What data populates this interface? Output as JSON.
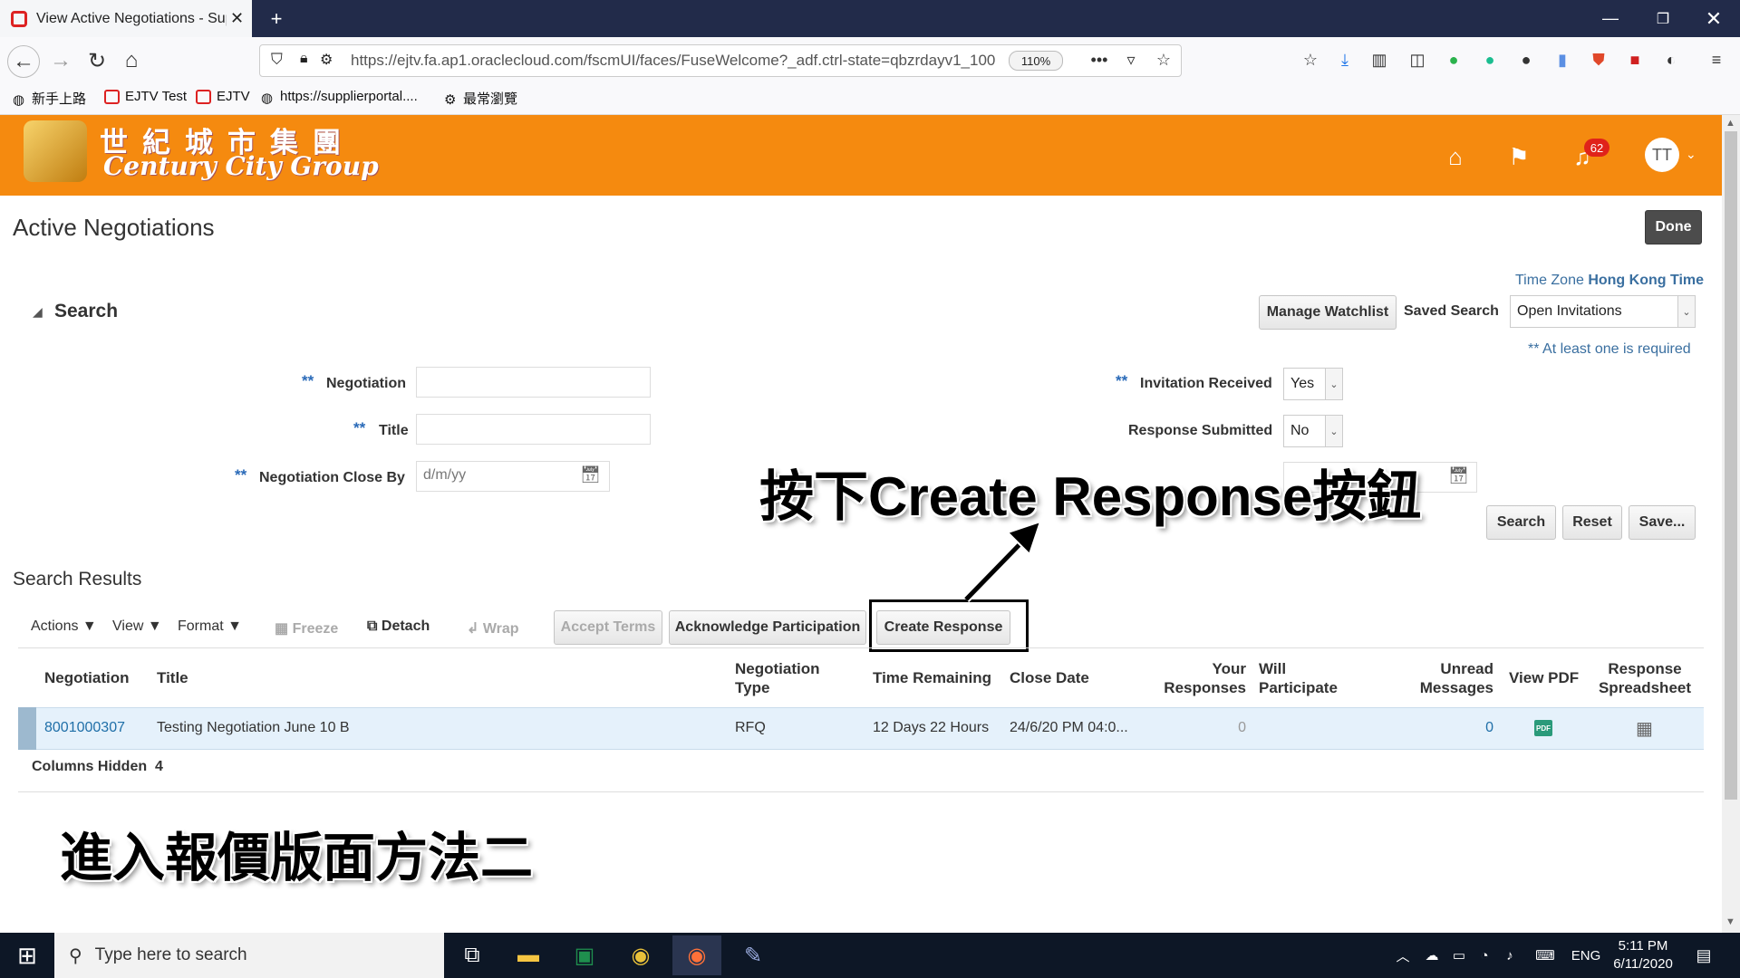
{
  "browser": {
    "tab_title": "View Active Negotiations - Sup",
    "url": "https://ejtv.fa.ap1.oraclecloud.com/fscmUI/faces/FuseWelcome?_adf.ctrl-state=qbzrdayv1_100",
    "zoom": "110%",
    "bookmarks": [
      "新手上路",
      "EJTV Test",
      "EJTV",
      "https://supplierportal....",
      "最常瀏覽"
    ]
  },
  "header": {
    "brand_cn": "世紀城市集團",
    "brand_en": "Century City Group",
    "notification_count": "62",
    "avatar_initials": "TT"
  },
  "page": {
    "title": "Active Negotiations",
    "done_label": "Done",
    "timezone_label": "Time Zone",
    "timezone_value": "Hong Kong Time",
    "search_section": "Search",
    "manage_watchlist": "Manage Watchlist",
    "saved_search_label": "Saved Search",
    "saved_search_value": "Open Invitations",
    "required_note": "** At least one is required",
    "fields": {
      "negotiation_label": "Negotiation",
      "title_label": "Title",
      "close_by_label": "Negotiation Close By",
      "close_by_placeholder": "d/m/yy",
      "invitation_received_label": "Invitation Received",
      "invitation_received_value": "Yes",
      "response_submitted_label": "Response Submitted",
      "response_submitted_value": "No",
      "req_marker": "**"
    },
    "search_button": "Search",
    "reset_button": "Reset",
    "save_button": "Save..."
  },
  "results": {
    "heading": "Search Results",
    "toolbar": {
      "actions": "Actions",
      "view": "View",
      "format": "Format",
      "freeze": "Freeze",
      "detach": "Detach",
      "wrap": "Wrap",
      "accept_terms": "Accept Terms",
      "acknowledge": "Acknowledge Participation",
      "create_response": "Create Response"
    },
    "columns": {
      "negotiation": "Negotiation",
      "title": "Title",
      "negotiation_type": [
        "Negotiation",
        "Type"
      ],
      "time_remaining": "Time Remaining",
      "close_date": "Close Date",
      "your_responses": [
        "Your",
        "Responses"
      ],
      "will_participate": [
        "Will",
        "Participate"
      ],
      "unread_messages": [
        "Unread",
        "Messages"
      ],
      "view_pdf": "View PDF",
      "response_spreadsheet": [
        "Response",
        "Spreadsheet"
      ]
    },
    "rows": [
      {
        "negotiation": "8001000307",
        "title": "Testing Negotiation June 10 B",
        "type": "RFQ",
        "time_remaining": "12 Days 22 Hours",
        "close_date": "24/6/20 PM 04:0...",
        "your_responses": "0",
        "will_participate": "",
        "unread_messages": "0"
      }
    ],
    "columns_hidden_label": "Columns Hidden",
    "columns_hidden_count": "4"
  },
  "annotations": {
    "callout": "按下Create Response按鈕",
    "method": "進入報價版面方法二"
  },
  "taskbar": {
    "search_placeholder": "Type here to search",
    "lang": "ENG",
    "time": "5:11 PM",
    "date": "6/11/2020"
  },
  "colors": {
    "header_orange": "#f58a0f",
    "link_blue": "#1f6fa8",
    "tabbar": "#222b4a"
  }
}
